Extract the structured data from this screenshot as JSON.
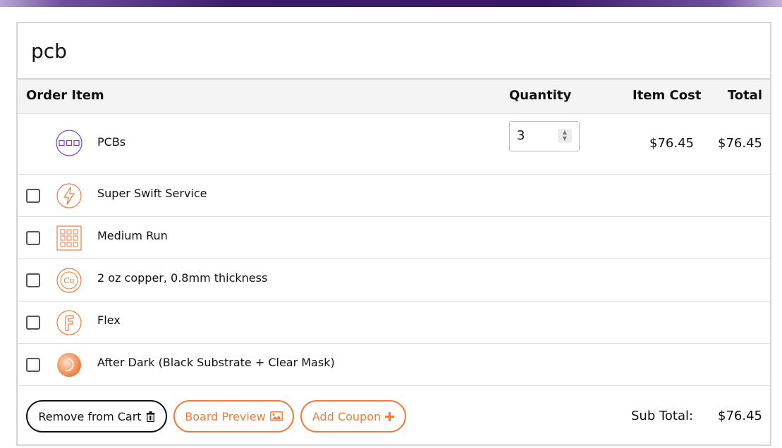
{
  "cart": {
    "title": "pcb",
    "headers": {
      "order_item": "Order Item",
      "quantity": "Quantity",
      "item_cost": "Item Cost",
      "total": "Total"
    },
    "main_item": {
      "name": "PCBs",
      "quantity": "3",
      "item_cost": "$76.45",
      "total": "$76.45",
      "icon": "pcb-board-icon"
    },
    "options": [
      {
        "name": "Super Swift Service",
        "icon": "lightning-icon",
        "checked": false
      },
      {
        "name": "Medium Run",
        "icon": "panel-grid-icon",
        "checked": false
      },
      {
        "name": "2 oz copper, 0.8mm thickness",
        "icon": "copper-icon",
        "checked": false
      },
      {
        "name": "Flex",
        "icon": "flex-icon",
        "checked": false
      },
      {
        "name": "After Dark (Black Substrate + Clear Mask)",
        "icon": "after-dark-icon",
        "checked": false
      }
    ],
    "buttons": {
      "remove": "Remove from Cart",
      "preview": "Board Preview",
      "coupon": "Add Coupon"
    },
    "subtotal": {
      "label": "Sub Total:",
      "value": "$76.45"
    },
    "colors": {
      "accent_orange": "#f07a3a",
      "pcb_purple": "#7a3fd0",
      "header_purple": "#3d1c6b"
    }
  }
}
